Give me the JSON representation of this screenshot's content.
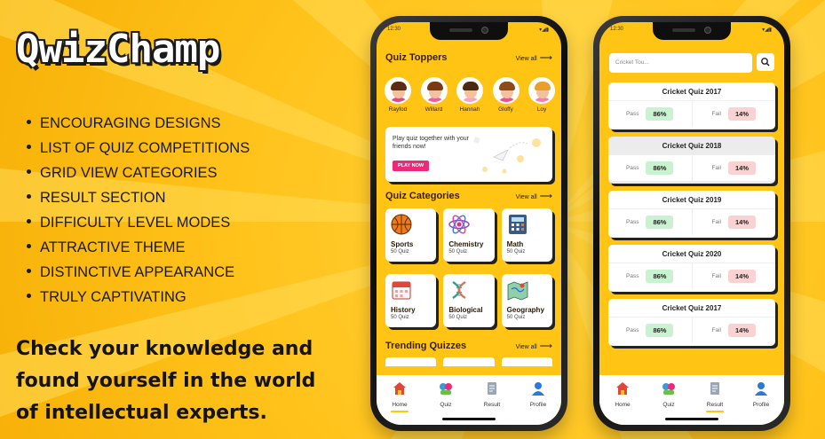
{
  "brand": "QwizChamp",
  "features": [
    "ENCOURAGING DESIGNS",
    "LIST OF QUIZ COMPETITIONS",
    "GRID VIEW CATEGORIES",
    "RESULT SECTION",
    "DIFFICULTY LEVEL MODES",
    "ATTRACTIVE THEME",
    "DISTINCTIVE APPEARANCE",
    "TRULY CAPTIVATING"
  ],
  "tagline": "Check your knowledge and found yourself in the world of intellectual experts.",
  "phone1": {
    "time": "12:30",
    "toppers_title": "Quiz Toppers",
    "view_all": "View all",
    "toppers": [
      {
        "name": "Rayfod",
        "hair": "#5a2d12",
        "shirt": "#d94a8c"
      },
      {
        "name": "Willard",
        "hair": "#7a3a12",
        "shirt": "#f25c9a"
      },
      {
        "name": "Hannah",
        "hair": "#4a2a10",
        "shirt": "#f7a2c4"
      },
      {
        "name": "Gloffy",
        "hair": "#8a4a1a",
        "shirt": "#ef4f8f"
      },
      {
        "name": "Loy",
        "hair": "#e8a02a",
        "shirt": "#f080b0"
      }
    ],
    "promo_text": "Play quiz together with your friends now!",
    "promo_button": "PLAY NOW",
    "categories_title": "Quiz Categories",
    "categories": [
      {
        "label": "Sports",
        "count": "50 Quiz",
        "icon": "basketball-icon"
      },
      {
        "label": "Chemistry",
        "count": "50 Quiz",
        "icon": "atom-icon"
      },
      {
        "label": "Math",
        "count": "50 Quiz",
        "icon": "calculator-icon"
      },
      {
        "label": "History",
        "count": "50 Quiz",
        "icon": "calendar-icon"
      },
      {
        "label": "Biological",
        "count": "50 Quiz",
        "icon": "dna-icon"
      },
      {
        "label": "Geography",
        "count": "50 Quiz",
        "icon": "map-icon"
      }
    ],
    "trending_title": "Trending Quizzes"
  },
  "phone2": {
    "time": "12:30",
    "search_placeholder": "Cricket Tou...",
    "pass_label": "Pass",
    "fail_label": "Fail",
    "results": [
      {
        "title": "Cricket Quiz 2017",
        "pass": "86%",
        "fail": "14%"
      },
      {
        "title": "Cricket Quiz 2018",
        "pass": "86%",
        "fail": "14%"
      },
      {
        "title": "Cricket Quiz 2019",
        "pass": "86%",
        "fail": "14%"
      },
      {
        "title": "Cricket Quiz 2020",
        "pass": "86%",
        "fail": "14%"
      },
      {
        "title": "Cricket Quiz 2017",
        "pass": "86%",
        "fail": "14%"
      }
    ]
  },
  "tabs": [
    {
      "label": "Home",
      "icon": "home-icon"
    },
    {
      "label": "Quiz",
      "icon": "quiz-icon"
    },
    {
      "label": "Result",
      "icon": "result-icon"
    },
    {
      "label": "Profile",
      "icon": "profile-icon"
    }
  ],
  "colors": {
    "accent": "#ffc414",
    "pink": "#f0287a",
    "pass": "#c9f2d0",
    "fail": "#fbd2d2"
  }
}
